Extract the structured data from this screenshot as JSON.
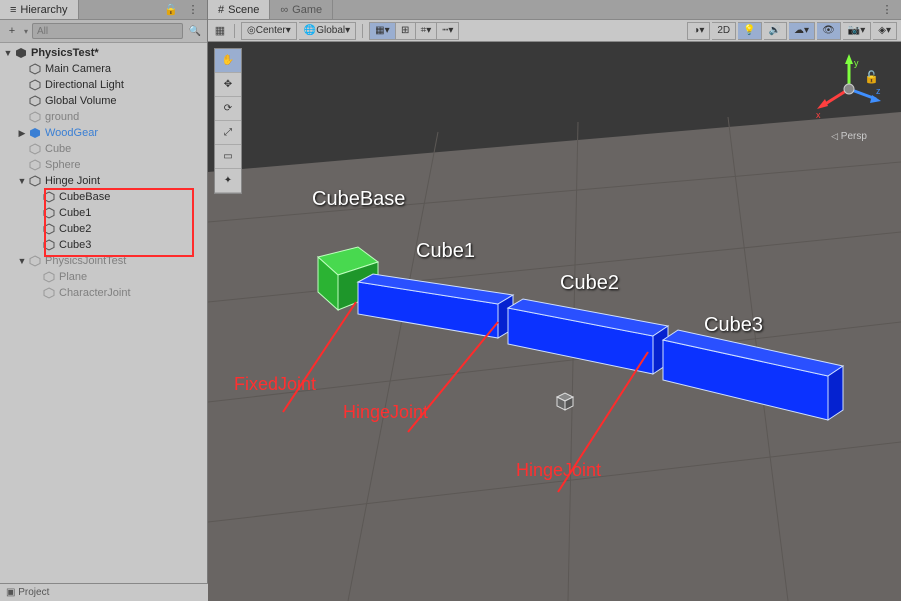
{
  "hierarchy": {
    "tab_label": "Hierarchy",
    "search_placeholder": "All",
    "scene_root": "PhysicsTest*",
    "items": {
      "main_camera": "Main Camera",
      "directional_light": "Directional Light",
      "global_volume": "Global Volume",
      "ground": "ground",
      "wood_gear": "WoodGear",
      "cube": "Cube",
      "sphere": "Sphere",
      "hinge_joint": "Hinge Joint",
      "cube_base": "CubeBase",
      "cube1": "Cube1",
      "cube2": "Cube2",
      "cube3": "Cube3",
      "physics_joint_test": "PhysicsJointTest",
      "plane": "Plane",
      "character_joint": "CharacterJoint"
    }
  },
  "scene": {
    "tab_scene": "Scene",
    "tab_game": "Game",
    "toolbar": {
      "pivot": "Center",
      "handle": "Global",
      "mode_2d": "2D",
      "persp": "Persp"
    },
    "labels": {
      "cube_base": "CubeBase",
      "cube1": "Cube1",
      "cube2": "Cube2",
      "cube3": "Cube3"
    },
    "annotations": {
      "fixed_joint": "FixedJoint",
      "hinge_joint_1": "HingeJoint",
      "hinge_joint_2": "HingeJoint"
    },
    "axes": {
      "x": "x",
      "y": "y",
      "z": "z"
    }
  },
  "footer": {
    "project_label": "Project"
  },
  "colors": {
    "cube_base": "#2ecc40",
    "cube_body": "#0b32ff",
    "ground": "#696563",
    "sky": "#393939",
    "highlight": "#ff2b2b"
  }
}
